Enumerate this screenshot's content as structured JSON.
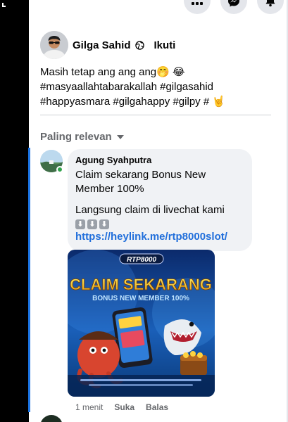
{
  "post": {
    "author": "Gilga Sahid",
    "follow_label": "Ikuti",
    "caption_line1": "Masih tetap ang ang ang",
    "caption_line1_emoji": "🤭 😂",
    "caption_line2": "#masyaallahtabarakallah #gilgasahid",
    "caption_line3": "#happyasmara #gilgahappy #gilpy #",
    "caption_line3_emoji": "🤘"
  },
  "comments_sort": {
    "label": "Paling relevan"
  },
  "comment": {
    "author": "Agung Syahputra",
    "text_line1": "Claim sekarang Bonus New Member 100%",
    "text_line2": "Langsung claim di livechat kami",
    "arrows": [
      "⬇",
      "⬇",
      "⬇"
    ],
    "link": "https://heylink.me/rtp8000slot/",
    "image": {
      "logo": "RTP8000",
      "headline": "CLAIM SEKARANG",
      "subline": "BONUS NEW MEMBER 100%"
    },
    "time": "1 menit",
    "like_label": "Suka",
    "reply_label": "Balas"
  },
  "icons": [
    "grid-menu-icon",
    "messenger-icon",
    "notifications-icon",
    "globe-icon",
    "caret-down-icon"
  ],
  "colors": {
    "accent": "#1b74e4",
    "link": "#216fdb",
    "bubble": "#f0f2f5",
    "online": "#31a24c"
  }
}
